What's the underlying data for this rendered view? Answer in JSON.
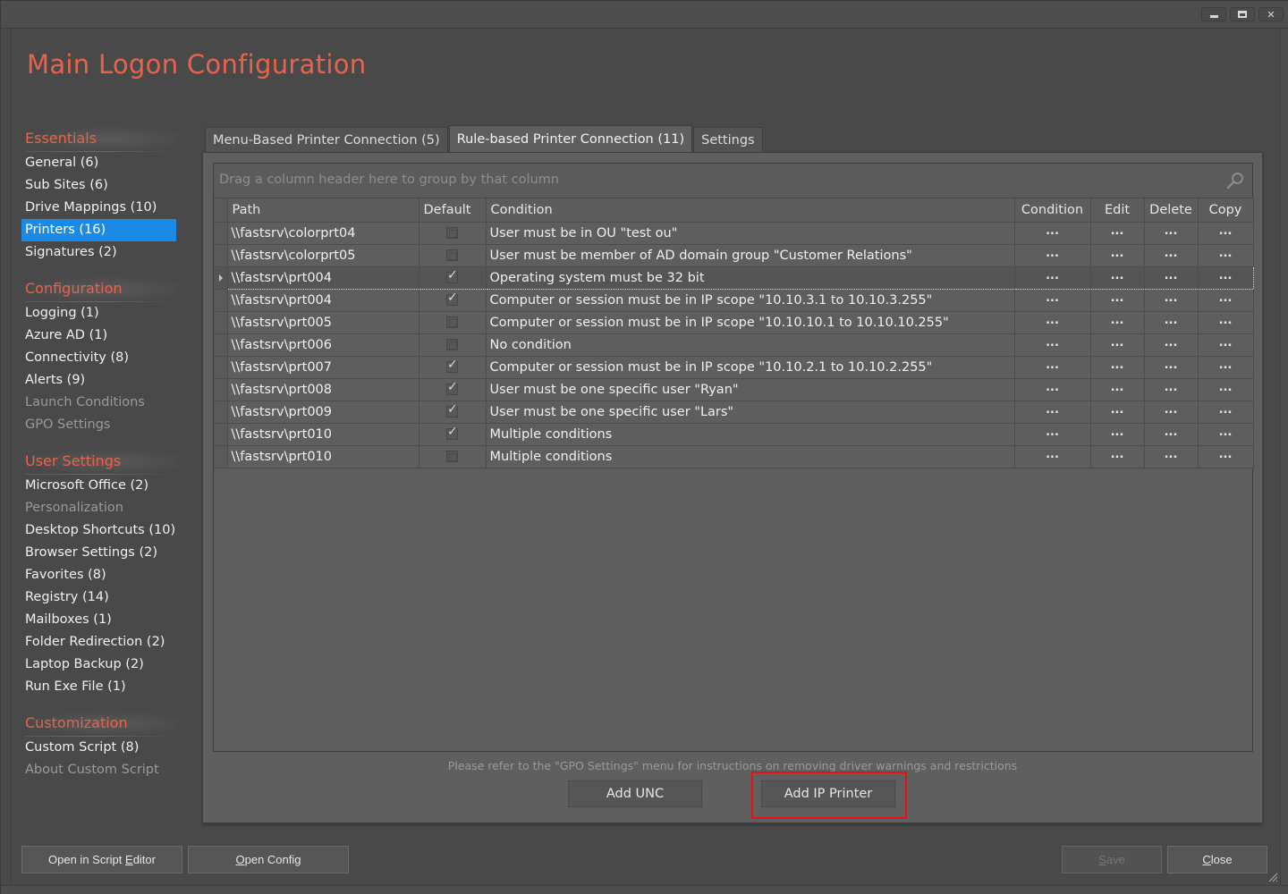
{
  "window": {
    "controls": {
      "minimize": "_",
      "maximize": "□",
      "close": "✕"
    }
  },
  "app_title": "Main Logon Configuration",
  "sidebar": {
    "sections": [
      {
        "header": "Essentials",
        "items": [
          {
            "label": "General (6)",
            "state": "normal"
          },
          {
            "label": "Sub Sites (6)",
            "state": "normal"
          },
          {
            "label": "Drive Mappings (10)",
            "state": "normal"
          },
          {
            "label": "Printers (16)",
            "state": "active"
          },
          {
            "label": "Signatures (2)",
            "state": "normal"
          }
        ]
      },
      {
        "header": "Configuration",
        "items": [
          {
            "label": "Logging (1)",
            "state": "normal"
          },
          {
            "label": "Azure AD (1)",
            "state": "normal"
          },
          {
            "label": "Connectivity (8)",
            "state": "normal"
          },
          {
            "label": "Alerts (9)",
            "state": "normal"
          },
          {
            "label": "Launch Conditions",
            "state": "disabled"
          },
          {
            "label": "GPO Settings",
            "state": "disabled"
          }
        ]
      },
      {
        "header": "User Settings",
        "items": [
          {
            "label": "Microsoft Office (2)",
            "state": "normal"
          },
          {
            "label": "Personalization",
            "state": "disabled"
          },
          {
            "label": "Desktop Shortcuts (10)",
            "state": "normal"
          },
          {
            "label": "Browser Settings (2)",
            "state": "normal"
          },
          {
            "label": "Favorites (8)",
            "state": "normal"
          },
          {
            "label": "Registry (14)",
            "state": "normal"
          },
          {
            "label": "Mailboxes (1)",
            "state": "normal"
          },
          {
            "label": "Folder Redirection (2)",
            "state": "normal"
          },
          {
            "label": "Laptop Backup (2)",
            "state": "normal"
          },
          {
            "label": "Run Exe File (1)",
            "state": "normal"
          }
        ]
      },
      {
        "header": "Customization",
        "items": [
          {
            "label": "Custom Script (8)",
            "state": "normal"
          },
          {
            "label": "About Custom Script",
            "state": "disabled"
          }
        ]
      }
    ]
  },
  "tabs": [
    {
      "label": "Menu-Based Printer Connection (5)",
      "active": false
    },
    {
      "label": "Rule-based Printer Connection (11)",
      "active": true
    },
    {
      "label": "Settings",
      "active": false
    }
  ],
  "grid": {
    "group_panel_text": "Drag a column header here to group by that column",
    "columns": [
      "Path",
      "Default",
      "Condition",
      "Condition",
      "Edit",
      "Delete",
      "Copy"
    ],
    "action_label": "...",
    "rows": [
      {
        "path": "\\\\fastsrv\\colorprt04",
        "default": false,
        "condition": "User must be in OU \"test ou\"",
        "selected": false
      },
      {
        "path": "\\\\fastsrv\\colorprt05",
        "default": false,
        "condition": "User must be member of AD domain group \"Customer Relations\"",
        "selected": false
      },
      {
        "path": "\\\\fastsrv\\prt004",
        "default": true,
        "condition": "Operating system must be 32 bit",
        "selected": true
      },
      {
        "path": "\\\\fastsrv\\prt004",
        "default": true,
        "condition": "Computer or session must be in IP scope \"10.10.3.1 to 10.10.3.255\"",
        "selected": false
      },
      {
        "path": "\\\\fastsrv\\prt005",
        "default": false,
        "condition": "Computer or session must be in IP scope \"10.10.10.1 to 10.10.10.255\"",
        "selected": false
      },
      {
        "path": "\\\\fastsrv\\prt006",
        "default": false,
        "condition": "No condition",
        "selected": false
      },
      {
        "path": "\\\\fastsrv\\prt007",
        "default": true,
        "condition": "Computer or session must be in IP scope \"10.10.2.1 to 10.10.2.255\"",
        "selected": false
      },
      {
        "path": "\\\\fastsrv\\prt008",
        "default": true,
        "condition": "User must be one specific user \"Ryan\"",
        "selected": false
      },
      {
        "path": "\\\\fastsrv\\prt009",
        "default": true,
        "condition": "User must be one specific user \"Lars\"",
        "selected": false
      },
      {
        "path": "\\\\fastsrv\\prt010",
        "default": true,
        "condition": "Multiple conditions",
        "selected": false
      },
      {
        "path": "\\\\fastsrv\\prt010",
        "default": false,
        "condition": "Multiple conditions",
        "selected": false
      }
    ]
  },
  "panel": {
    "hint": "Please refer to the \"GPO Settings\" menu for instructions on removing driver warnings and restrictions",
    "add_unc_label": "Add UNC",
    "add_ip_printer_label": "Add IP Printer",
    "highlight_color": "#e81010"
  },
  "footer": {
    "open_script_editor": {
      "before": "Open in Script ",
      "mnemonic": "E",
      "after": "ditor"
    },
    "open_config": {
      "before": "",
      "mnemonic": "O",
      "after": "pen Config"
    },
    "save": {
      "before": "",
      "mnemonic": "S",
      "after": "ave",
      "disabled": true
    },
    "close": {
      "before": "",
      "mnemonic": "C",
      "after": "lose"
    }
  },
  "colors": {
    "accent": "#e8634a",
    "selection": "#1b8ae6"
  }
}
